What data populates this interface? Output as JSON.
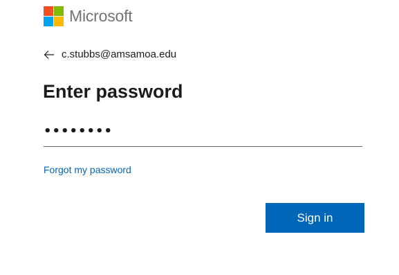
{
  "brand": {
    "name": "Microsoft",
    "logo_colors": [
      "#f25022",
      "#7fba00",
      "#00a4ef",
      "#ffb900"
    ]
  },
  "identity": {
    "back_icon": "back-arrow-icon",
    "email": "c.stubbs@amsamoa.edu"
  },
  "title": "Enter password",
  "password": {
    "masked_value": "••••••••"
  },
  "forgot_link": "Forgot my password",
  "signin_button": "Sign in",
  "colors": {
    "accent": "#0067b8",
    "text": "#1b1b1b"
  }
}
